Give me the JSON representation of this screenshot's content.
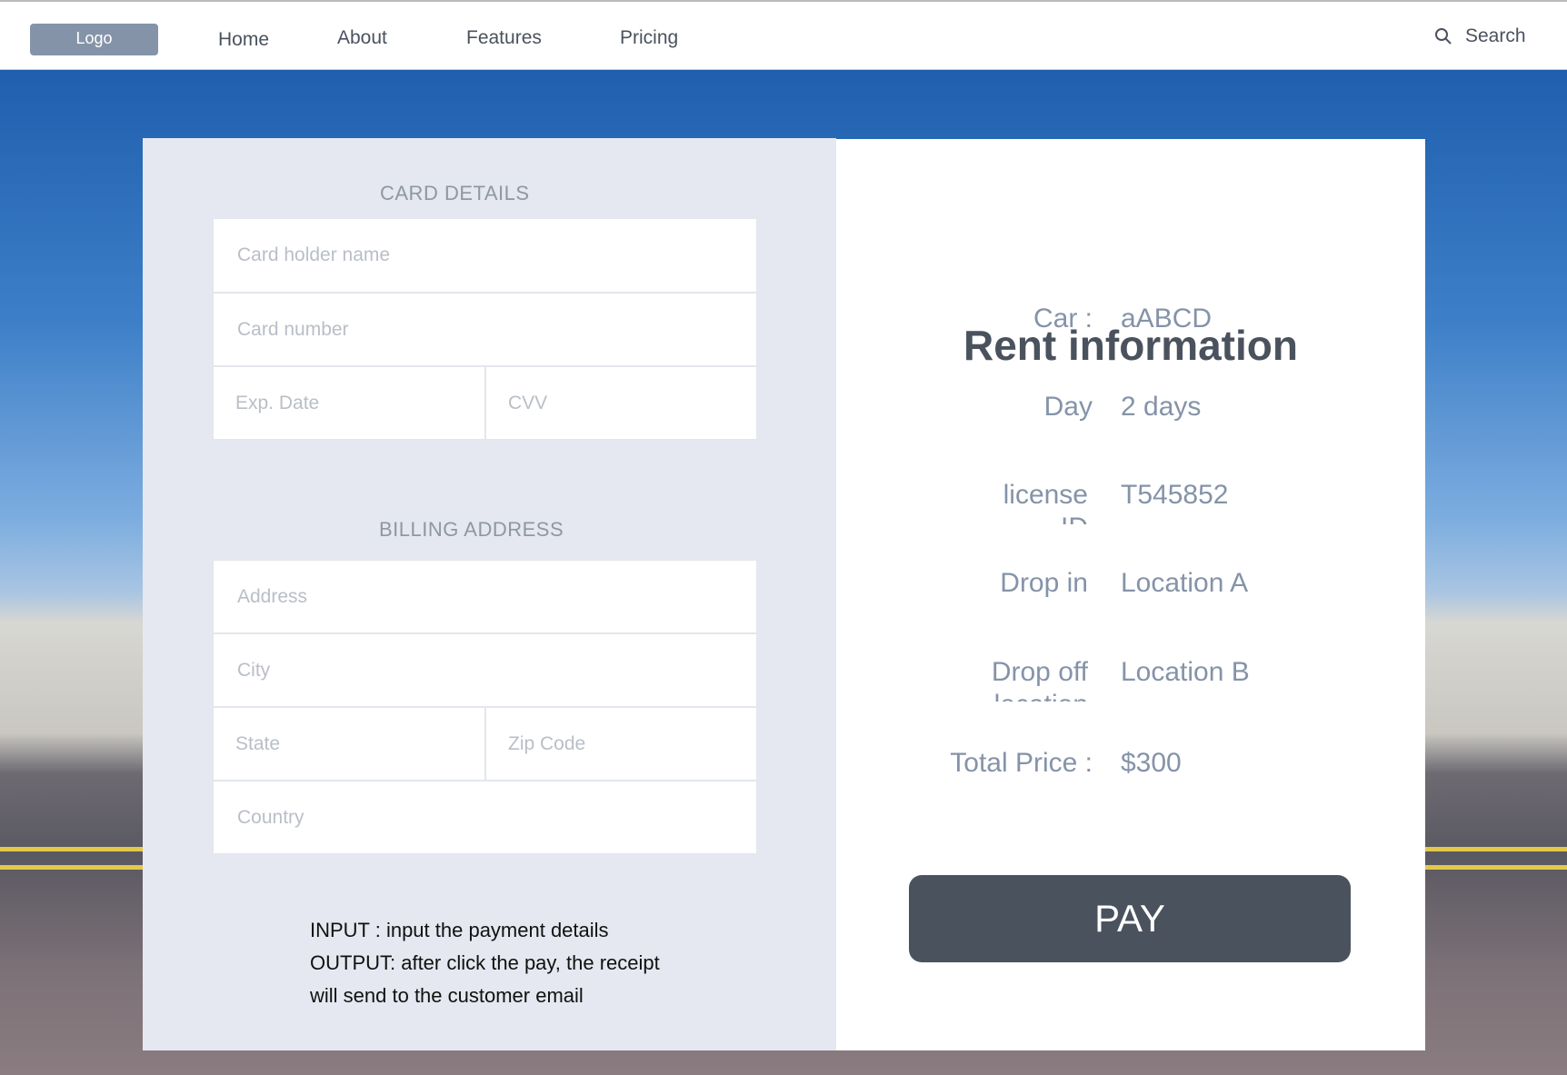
{
  "nav": {
    "logo": "Logo",
    "items": [
      "Home",
      "About",
      "Features",
      "Pricing"
    ],
    "search": "Search"
  },
  "card": {
    "title": "CARD DETAILS",
    "holder": "Card holder name",
    "number": "Card number",
    "exp": "Exp. Date",
    "cvv": "CVV"
  },
  "billing": {
    "title": "BILLING ADDRESS",
    "address": "Address",
    "city": "City",
    "state": "State",
    "zip": "Zip Code",
    "country": "Country"
  },
  "notes": [
    "INPUT : input the payment details",
    "OUTPUT: after click the pay, the receipt",
    "will send to the customer email"
  ],
  "rent": {
    "title": "Rent information",
    "rows": [
      {
        "label": "Car :",
        "value": "aABCD"
      },
      {
        "label": "Day",
        "value": "2 days"
      },
      {
        "label": "license ID",
        "value": "T545852"
      },
      {
        "label": "Drop in",
        "value": "Location A"
      },
      {
        "label": "Drop off location",
        "value": "Location B"
      },
      {
        "label": "Total Price :",
        "value": "$300"
      }
    ],
    "pay": "PAY"
  }
}
